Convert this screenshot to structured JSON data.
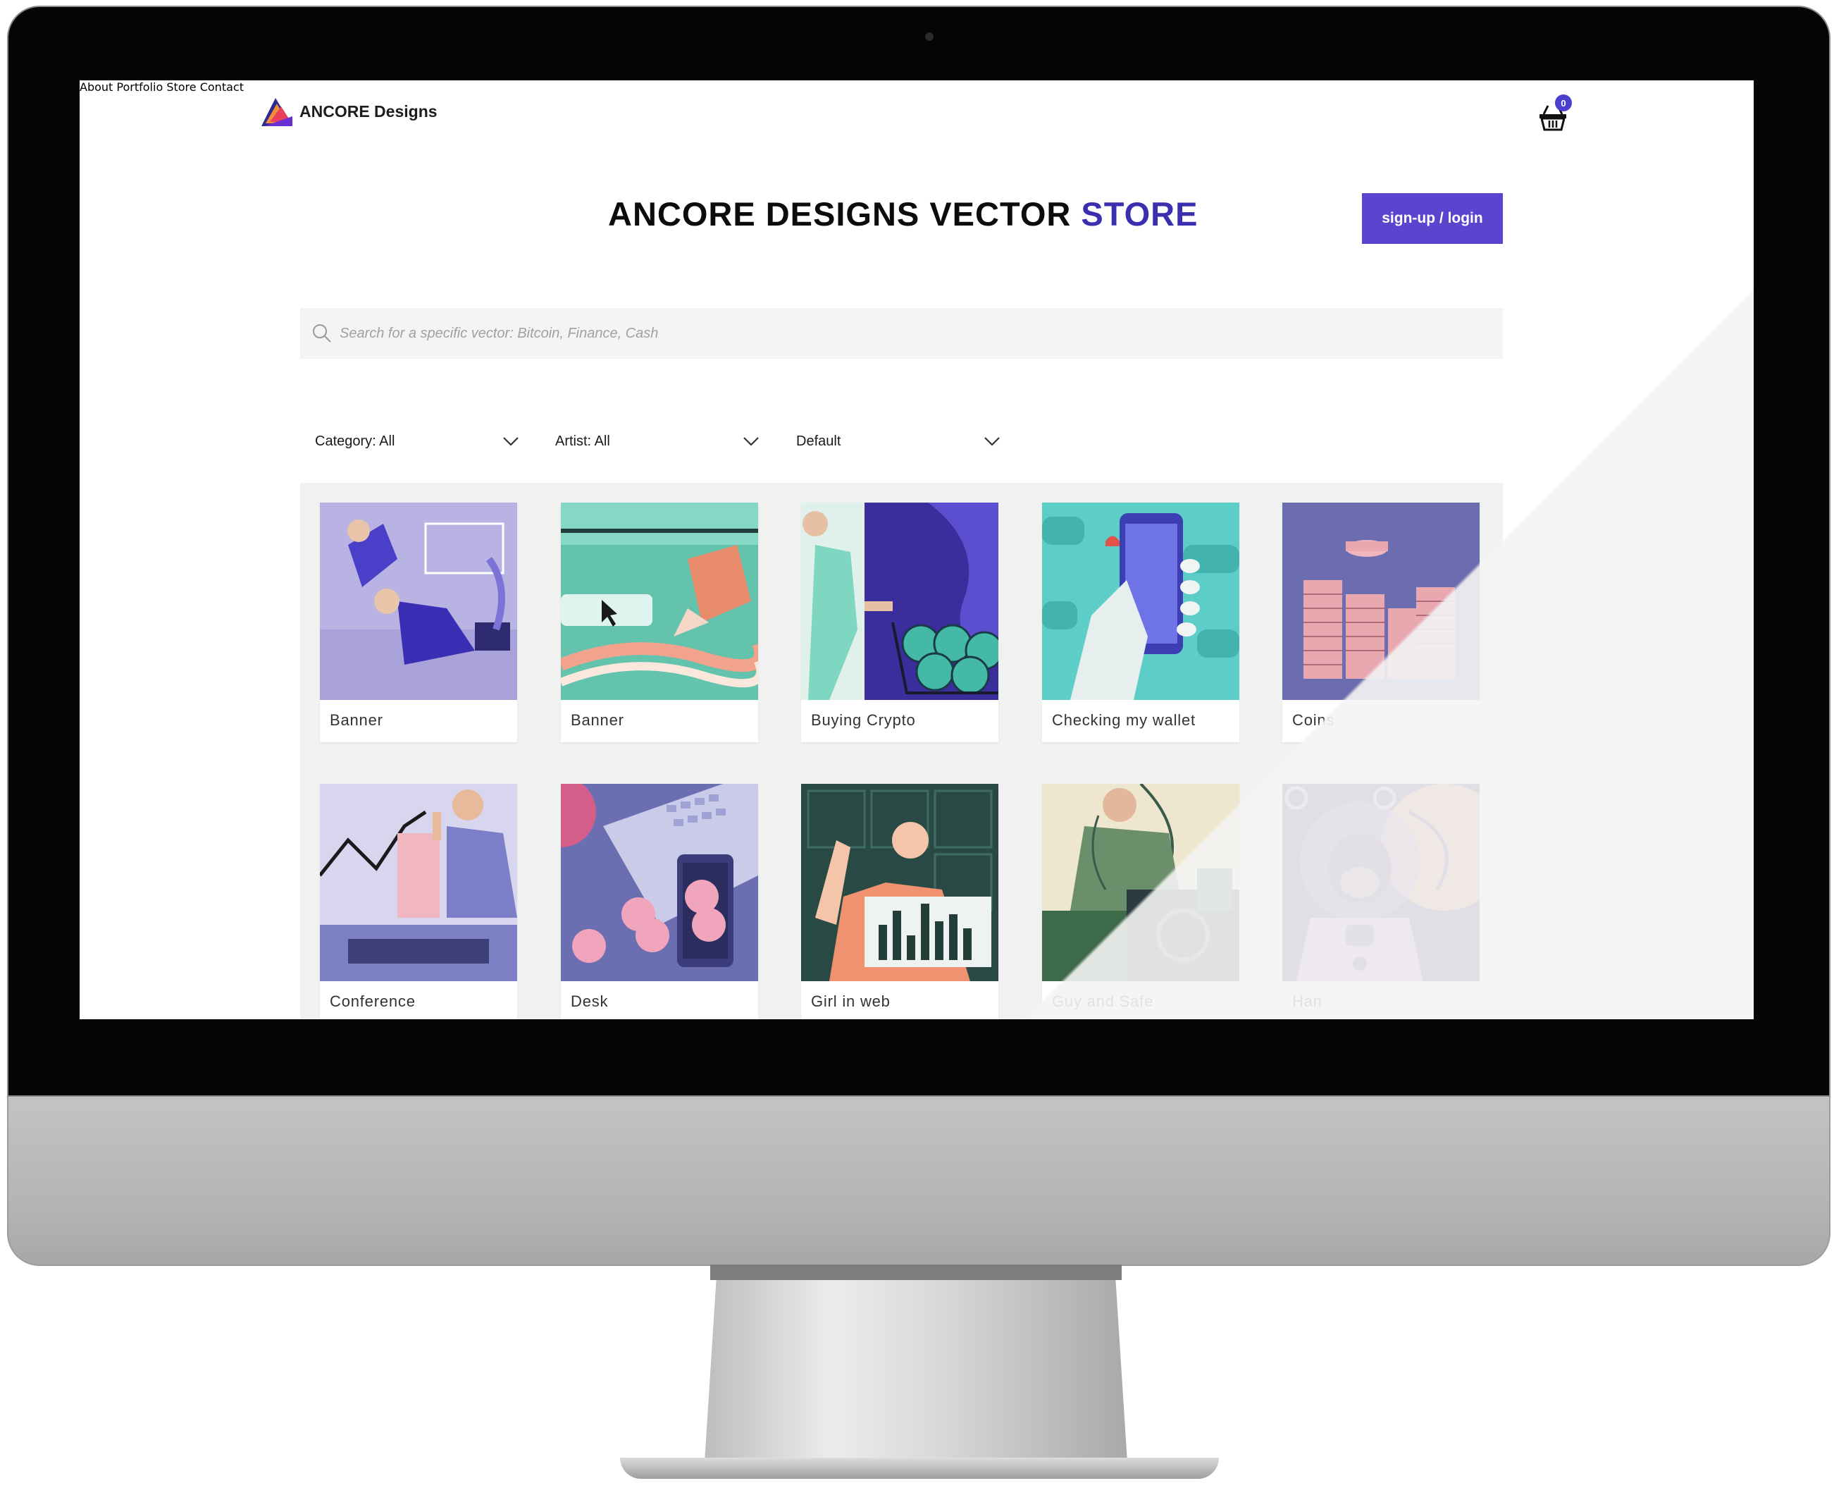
{
  "brand": {
    "name": "ANCORE Designs"
  },
  "nav": {
    "items": [
      {
        "label": "About"
      },
      {
        "label": "Portfolio"
      },
      {
        "label": "Store"
      },
      {
        "label": "Contact"
      }
    ],
    "cart_count": "0"
  },
  "header": {
    "title_main": "ANCORE DESIGNS VECTOR ",
    "title_accent": "STORE",
    "signup_label": "sign-up / login"
  },
  "search": {
    "placeholder": "Search for a specific vector: Bitcoin, Finance, Cash",
    "value": ""
  },
  "filters": [
    {
      "label": "Category: All"
    },
    {
      "label": "Artist: All"
    },
    {
      "label": "Default"
    }
  ],
  "products": [
    {
      "title": "Banner",
      "icon": "people-with-laptops-illustration"
    },
    {
      "title": "Banner",
      "icon": "pencil-and-browser-illustration"
    },
    {
      "title": "Buying Crypto",
      "icon": "cart-with-coins-illustration"
    },
    {
      "title": "Checking my wallet",
      "icon": "hand-holding-phone-illustration"
    },
    {
      "title": "Coins",
      "icon": "coin-stacks-illustration"
    },
    {
      "title": "Conference",
      "icon": "man-with-chart-illustration"
    },
    {
      "title": "Desk",
      "icon": "keyboard-and-phone-illustration"
    },
    {
      "title": "Girl in web",
      "icon": "woman-with-bar-chart-illustration"
    },
    {
      "title": "Guy and Safe",
      "icon": "man-at-safe-illustration"
    },
    {
      "title": "Han",
      "icon": "ape-astronaut-illustration"
    }
  ],
  "colors": {
    "accent": "#3b2fb0",
    "button": "#5b45cf",
    "badge": "#4a3fcf"
  }
}
